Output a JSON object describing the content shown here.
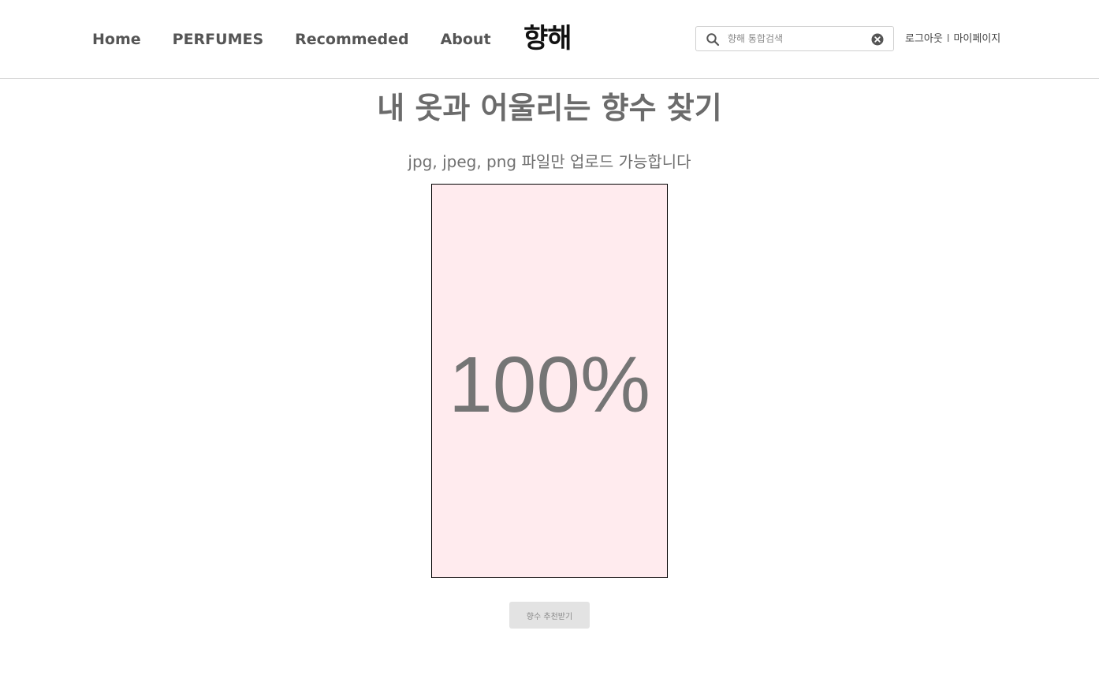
{
  "nav": {
    "items": [
      {
        "label": "Home"
      },
      {
        "label": "PERFUMES"
      },
      {
        "label": "Recommeded"
      },
      {
        "label": "About"
      }
    ]
  },
  "logo": {
    "text": "향해"
  },
  "search": {
    "placeholder": "향해 통합검색",
    "value": ""
  },
  "user_links": {
    "logout": "로그아웃",
    "separator": "l",
    "mypage": "마이페이지"
  },
  "main": {
    "title": "내 옷과 어울리는 향수 찾기",
    "upload_hint": "jpg, jpeg, png 파일만 업로드 가능합니다",
    "upload_progress_text": "100%",
    "upload_progress_percent": 100,
    "recommend_button_label": "향수 추천받기"
  },
  "colors": {
    "upload_box_bg": "#ffebee",
    "text_gray": "#6b6b6b",
    "button_bg": "#e3e3e3"
  }
}
